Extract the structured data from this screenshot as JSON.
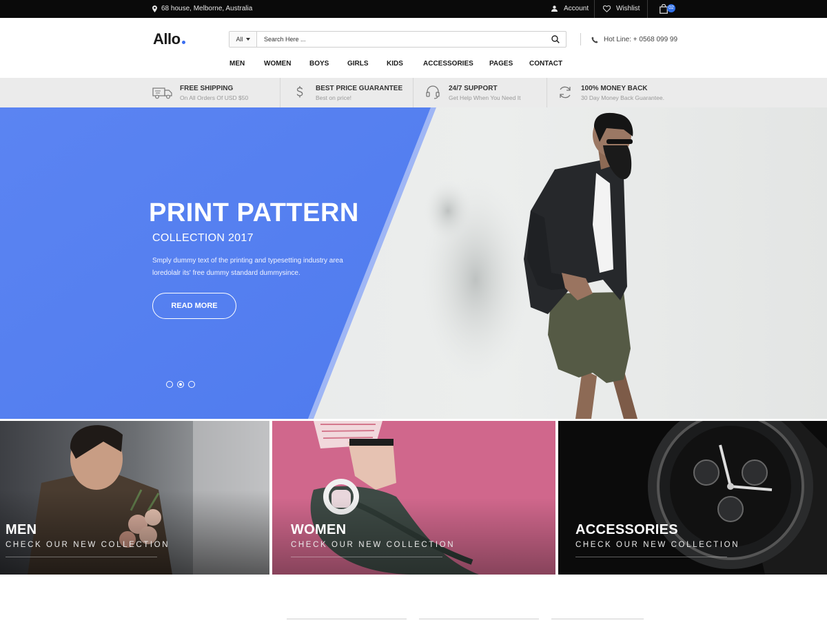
{
  "topbar": {
    "address": "68 house, Melborne, Australia",
    "account_label": "Account",
    "wishlist_label": "Wishlist",
    "cart_count": "02"
  },
  "header": {
    "logo_text": "Allo",
    "search": {
      "category": "All",
      "placeholder": "Search Here ..."
    },
    "hotline": "Hot Line: + 0568 099 99"
  },
  "nav": {
    "items": [
      "MEN",
      "WOMEN",
      "BOYS",
      "GIRLS",
      "KIDS",
      "ACCESSORIES",
      "PAGES",
      "CONTACT"
    ]
  },
  "features": [
    {
      "title": "FREE SHIPPING",
      "subtitle": "On All Orders Of USD $50",
      "icon": "delivery-truck-icon"
    },
    {
      "title": "BEST PRICE GUARANTEE",
      "subtitle": "Best on price!",
      "icon": "dollar-icon"
    },
    {
      "title": "24/7 SUPPORT",
      "subtitle": "Get Help When You Need It",
      "icon": "headset-icon"
    },
    {
      "title": "100% MONEY BACK",
      "subtitle": "30 Day Money Back Guarantee.",
      "icon": "refresh-icon"
    }
  ],
  "hero": {
    "title": "PRINT PATTERN",
    "subtitle": "COLLECTION 2017",
    "description": "Smply dummy text of the printing and typesetting industry area loredolalr its' free dummy standard dummysince.",
    "button_label": "READ MORE",
    "slides_total": 3,
    "active_slide": 2,
    "accent_color": "#5b83f0"
  },
  "categories": [
    {
      "name": "MEN",
      "subtitle": "CHECK OUR NEW COLLECTION"
    },
    {
      "name": "WOMEN",
      "subtitle": "CHECK OUR NEW COLLECTION"
    },
    {
      "name": "ACCESSORIES",
      "subtitle": "CHECK OUR NEW COLLECTION"
    }
  ]
}
